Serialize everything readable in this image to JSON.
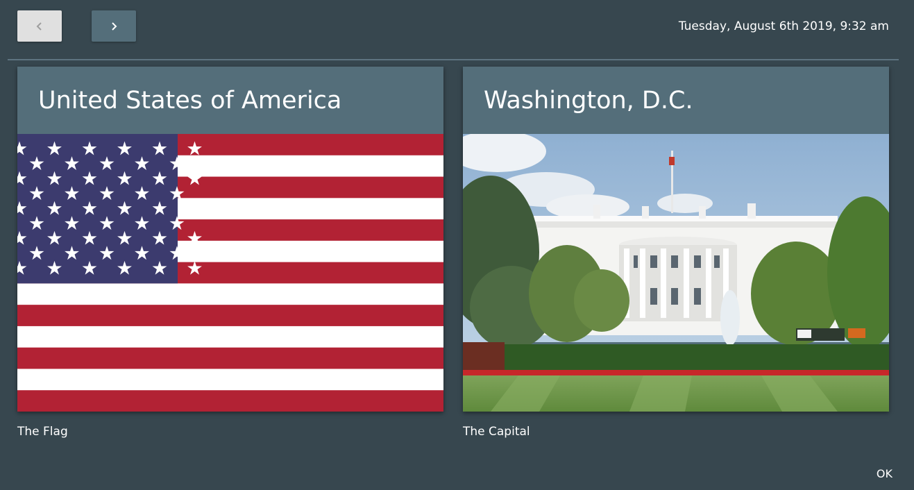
{
  "toolbar": {
    "back_icon": "chevron-left-icon",
    "forward_icon": "chevron-right-icon",
    "datetime": "Tuesday, August 6th 2019, 9:32 am"
  },
  "cards": [
    {
      "title": "United States of America",
      "image": "us-flag",
      "caption": "The Flag"
    },
    {
      "title": "Washington, D.C.",
      "image": "white-house-photo",
      "caption": "The Capital"
    }
  ],
  "footer": {
    "ok_label": "OK"
  },
  "colors": {
    "background": "#37474f",
    "card_header": "#546e7a",
    "flag_red": "#b22234",
    "flag_blue": "#3c3b6e",
    "back_button": "#e0e0e0",
    "forward_button": "#546e7a"
  }
}
